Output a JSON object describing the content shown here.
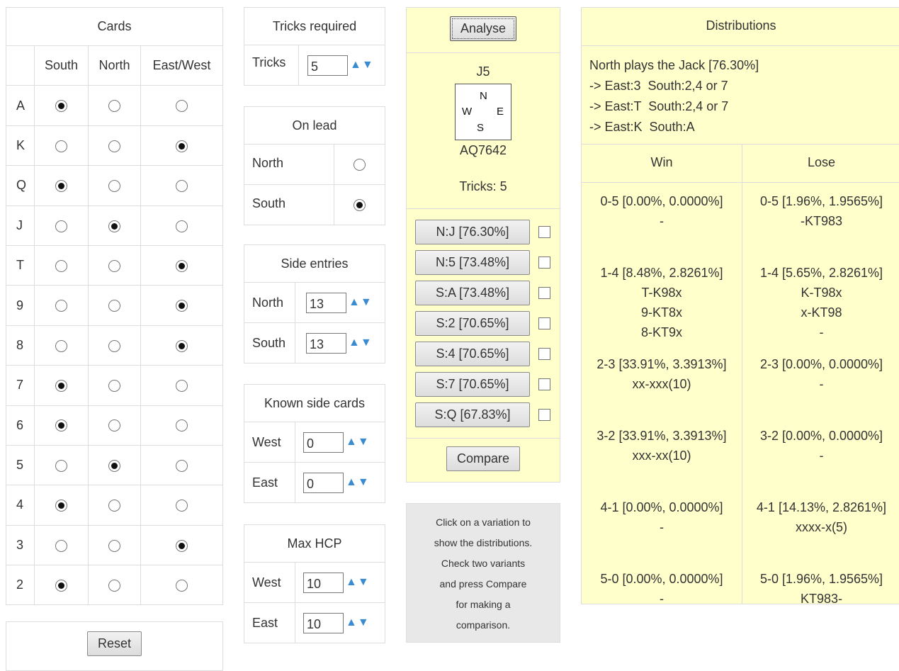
{
  "cards": {
    "title": "Cards",
    "columns": [
      "South",
      "North",
      "East/West"
    ],
    "rows": [
      {
        "rank": "A",
        "selected": 0
      },
      {
        "rank": "K",
        "selected": 2
      },
      {
        "rank": "Q",
        "selected": 0
      },
      {
        "rank": "J",
        "selected": 1
      },
      {
        "rank": "T",
        "selected": 2
      },
      {
        "rank": "9",
        "selected": 2
      },
      {
        "rank": "8",
        "selected": 2
      },
      {
        "rank": "7",
        "selected": 0
      },
      {
        "rank": "6",
        "selected": 0
      },
      {
        "rank": "5",
        "selected": 1
      },
      {
        "rank": "4",
        "selected": 0
      },
      {
        "rank": "3",
        "selected": 2
      },
      {
        "rank": "2",
        "selected": 0
      }
    ],
    "reset_label": "Reset"
  },
  "tricks_required": {
    "title": "Tricks required",
    "label": "Tricks",
    "value": "5"
  },
  "on_lead": {
    "title": "On lead",
    "north_label": "North",
    "south_label": "South",
    "selected": "South"
  },
  "side_entries": {
    "title": "Side entries",
    "north_label": "North",
    "north_value": "13",
    "south_label": "South",
    "south_value": "13"
  },
  "known_side_cards": {
    "title": "Known side cards",
    "west_label": "West",
    "west_value": "0",
    "east_label": "East",
    "east_value": "0"
  },
  "max_hcp": {
    "title": "Max HCP",
    "west_label": "West",
    "west_value": "10",
    "east_label": "East",
    "east_value": "10"
  },
  "analyse": {
    "button_label": "Analyse",
    "north_hand": "J5",
    "south_hand": "AQ7642",
    "compass": {
      "n": "N",
      "w": "W",
      "e": "E",
      "s": "S"
    },
    "tricks_text": "Tricks: 5",
    "variations": [
      "N:J [76.30%]",
      "N:5 [73.48%]",
      "S:A [73.48%]",
      "S:2 [70.65%]",
      "S:4 [70.65%]",
      "S:7 [70.65%]",
      "S:Q [67.83%]"
    ],
    "compare_label": "Compare"
  },
  "help": {
    "lines": [
      "Click on a variation to",
      "show the distributions.",
      "Check two variants",
      "and press Compare",
      "for making a",
      "comparison."
    ]
  },
  "distributions": {
    "title": "Distributions",
    "summary": [
      "North plays the Jack [76.30%]",
      "-> East:3  South:2,4 or 7",
      "-> East:T  South:2,4 or 7",
      "-> East:K  South:A"
    ],
    "win_header": "Win",
    "lose_header": "Lose",
    "win": [
      [
        "0-5 [0.00%, 0.0000%]",
        "-"
      ],
      [
        "1-4 [8.48%, 2.8261%]",
        "T-K98x",
        "9-KT8x",
        "8-KT9x"
      ],
      [
        "2-3 [33.91%, 3.3913%]",
        "xx-xxx(10)"
      ],
      [
        "3-2 [33.91%, 3.3913%]",
        "xxx-xx(10)"
      ],
      [
        "4-1 [0.00%, 0.0000%]",
        "-"
      ],
      [
        "5-0 [0.00%, 0.0000%]",
        "-"
      ]
    ],
    "lose": [
      [
        "0-5 [1.96%, 1.9565%]",
        "-KT983"
      ],
      [
        "1-4 [5.65%, 2.8261%]",
        "K-T98x",
        "x-KT98",
        "-"
      ],
      [
        "2-3 [0.00%, 0.0000%]",
        "-"
      ],
      [
        "3-2 [0.00%, 0.0000%]",
        "-"
      ],
      [
        "4-1 [14.13%, 2.8261%]",
        "xxxx-x(5)"
      ],
      [
        "5-0 [1.96%, 1.9565%]",
        "KT983-"
      ]
    ]
  },
  "colors": {
    "panel_yellow": "#ffffcc",
    "help_gray": "#e8e8e8",
    "arrow_blue": "#3a8bd0"
  }
}
